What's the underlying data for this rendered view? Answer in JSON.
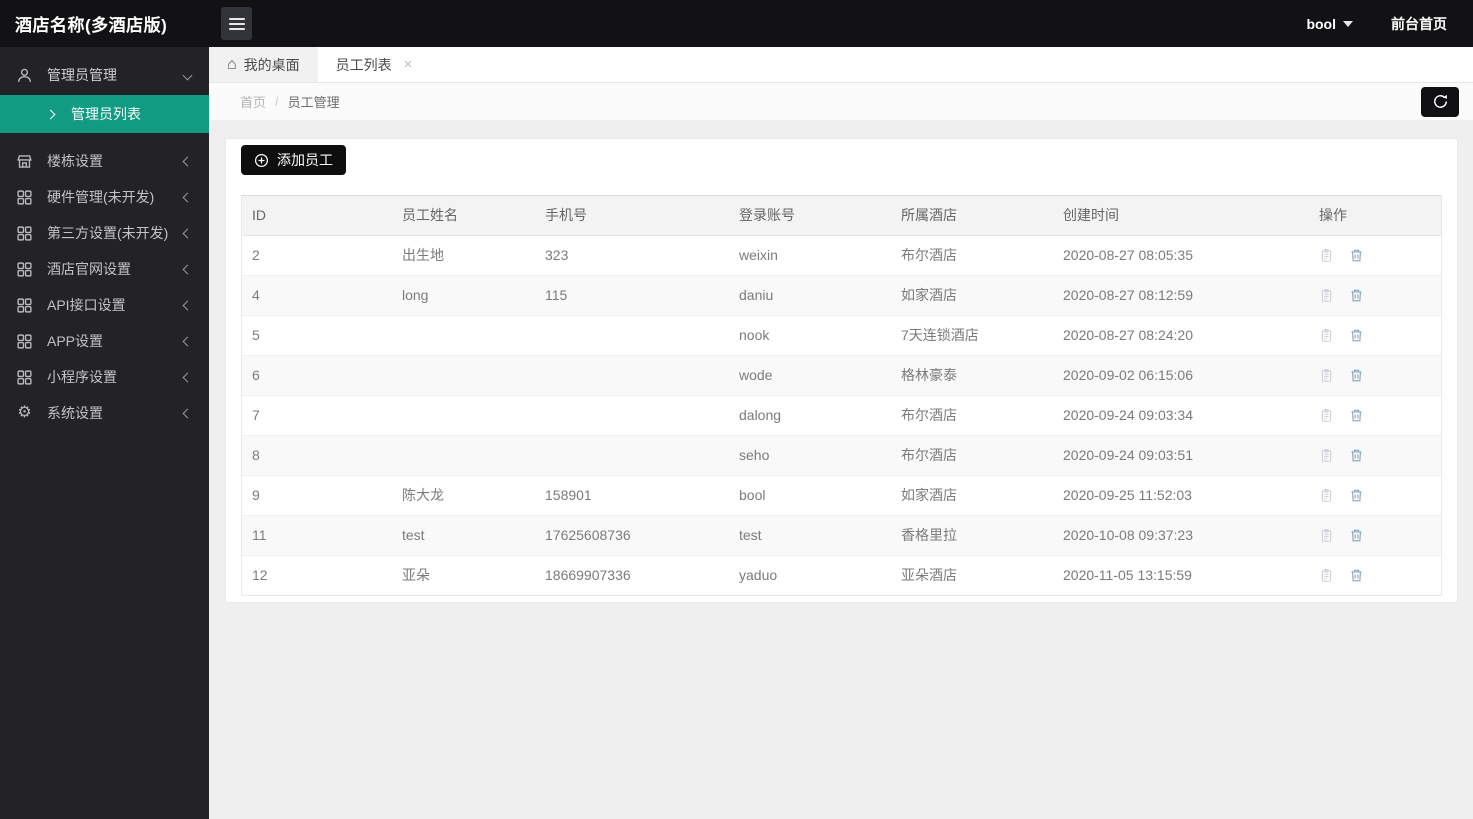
{
  "brand": {
    "title": "酒店名称(多酒店版)"
  },
  "topbar": {
    "username": "bool",
    "frontend_home": "前台首页"
  },
  "sidebar": {
    "admin_group": "管理员管理",
    "admin_sub_active": "管理员列表",
    "items": [
      "楼栋设置",
      "硬件管理(未开发)",
      "第三方设置(未开发)",
      "酒店官网设置",
      "API接口设置",
      "APP设置",
      "小程序设置",
      "系统设置"
    ]
  },
  "tabs": [
    {
      "label": "我的桌面"
    },
    {
      "label": "员工列表"
    }
  ],
  "breadcrumb": {
    "home": "首页",
    "separator": "/",
    "current": "员工管理"
  },
  "toolbar": {
    "add_employee": "添加员工"
  },
  "table": {
    "headers": [
      "ID",
      "员工姓名",
      "手机号",
      "登录账号",
      "所属酒店",
      "创建时间",
      "操作"
    ],
    "rows": [
      {
        "id": "2",
        "name": "出生地",
        "phone": "323",
        "account": "weixin",
        "hotel": "布尔酒店",
        "created": "2020-08-27 08:05:35"
      },
      {
        "id": "4",
        "name": "long",
        "phone": "115",
        "account": "daniu",
        "hotel": "如家酒店",
        "created": "2020-08-27 08:12:59"
      },
      {
        "id": "5",
        "name": "",
        "phone": "",
        "account": "nook",
        "hotel": "7天连锁酒店",
        "created": "2020-08-27 08:24:20"
      },
      {
        "id": "6",
        "name": "",
        "phone": "",
        "account": "wode",
        "hotel": "格林豪泰",
        "created": "2020-09-02 06:15:06"
      },
      {
        "id": "7",
        "name": "",
        "phone": "",
        "account": "dalong",
        "hotel": "布尔酒店",
        "created": "2020-09-24 09:03:34"
      },
      {
        "id": "8",
        "name": "",
        "phone": "",
        "account": "seho",
        "hotel": "布尔酒店",
        "created": "2020-09-24 09:03:51"
      },
      {
        "id": "9",
        "name": "陈大龙",
        "phone": "158901",
        "account": "bool",
        "hotel": "如家酒店",
        "created": "2020-09-25 11:52:03"
      },
      {
        "id": "11",
        "name": "test",
        "phone": "17625608736",
        "account": "test",
        "hotel": "香格里拉",
        "created": "2020-10-08 09:37:23"
      },
      {
        "id": "12",
        "name": "亚朵",
        "phone": "18669907336",
        "account": "yaduo",
        "hotel": "亚朵酒店",
        "created": "2020-11-05 13:15:59"
      }
    ]
  },
  "icons": {
    "home": "⌂",
    "close": "×",
    "gear": "⚙"
  },
  "colors": {
    "accent_teal": "#119b83",
    "topbar_bg": "#121215",
    "sidebar_bg": "#232327",
    "button_black": "#0e0e0e",
    "edit_icon": "#cdd2d9",
    "trash_icon": "#8ba3c2"
  }
}
